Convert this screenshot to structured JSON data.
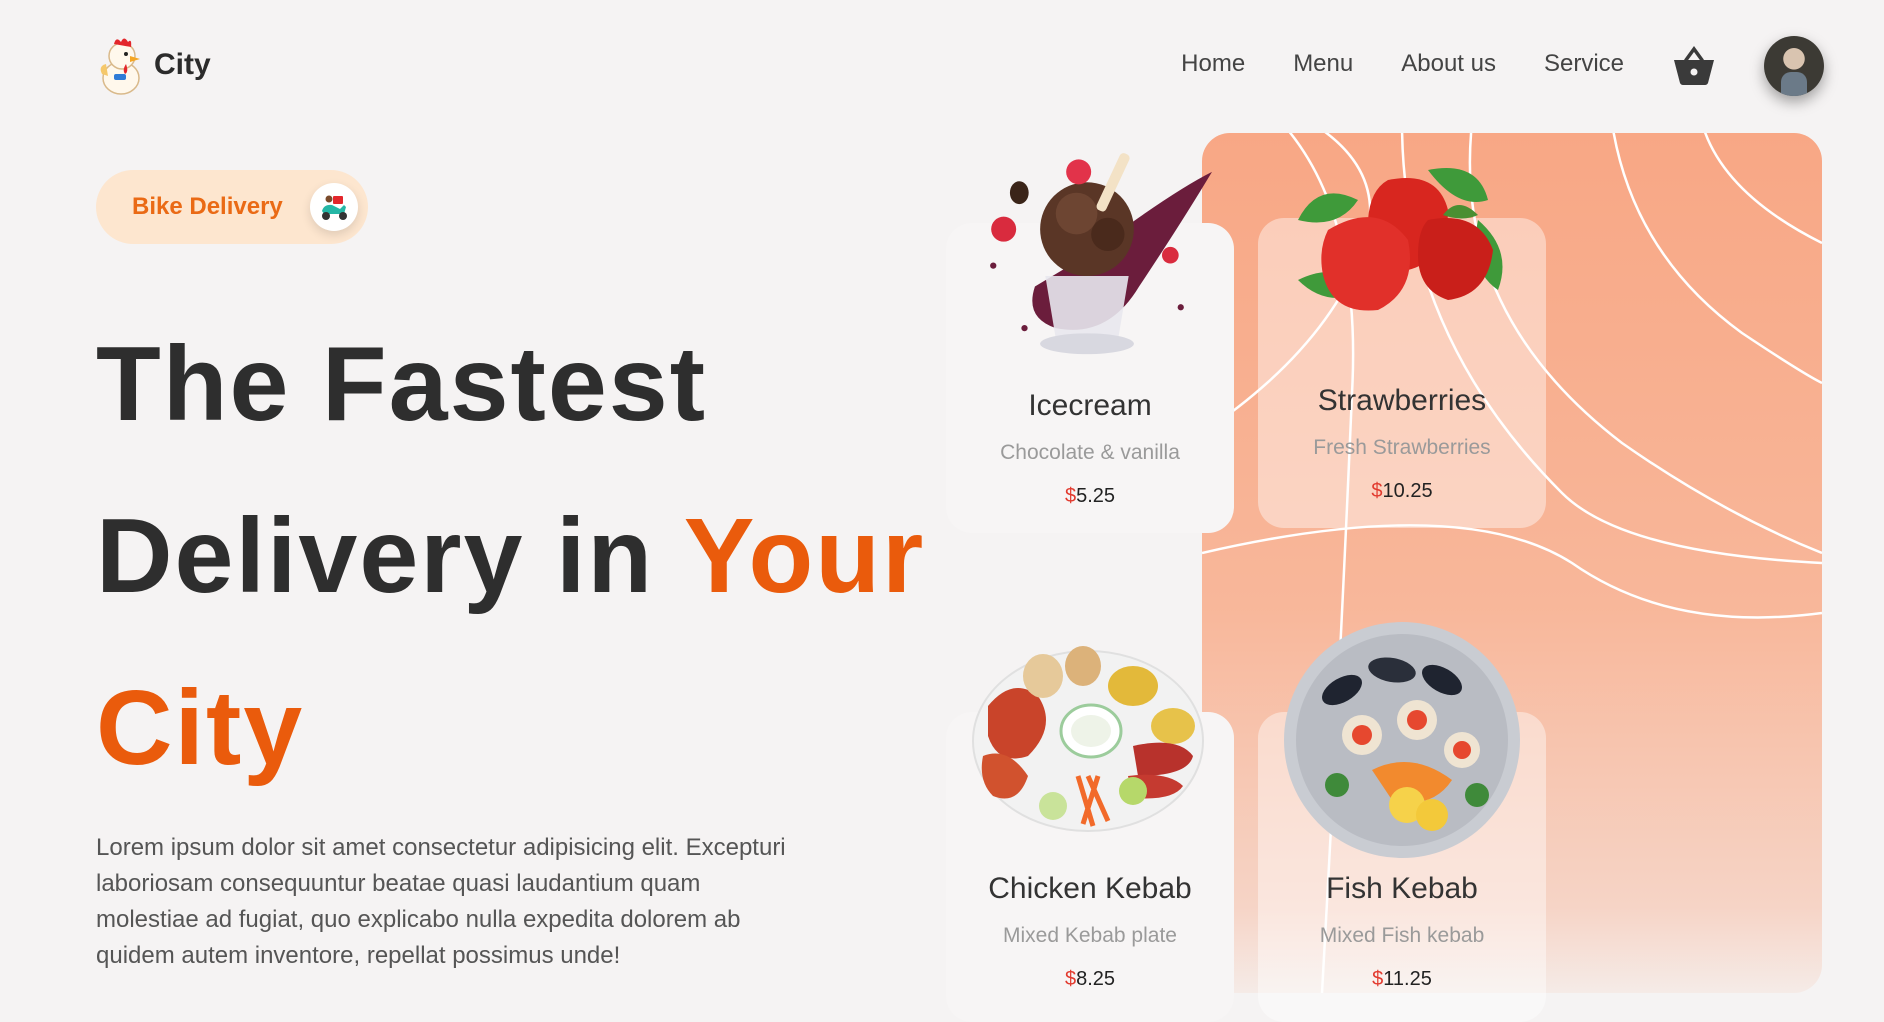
{
  "header": {
    "brand": "City",
    "nav": [
      "Home",
      "Menu",
      "About us",
      "Service"
    ]
  },
  "badge": {
    "label": "Bike Delivery"
  },
  "hero": {
    "line1": "The Fastest",
    "line2_dark": "Delivery in ",
    "line2_accent": "Your",
    "line3_accent": "City"
  },
  "description": "Lorem ipsum dolor sit amet consectetur adipisicing elit. Excepturi laboriosam consequuntur beatae quasi laudantium quam molestiae ad fugiat, quo explicabo nulla expedita dolorem ab quidem autem inventore, repellat possimus unde!",
  "cards": [
    {
      "name": "Icecream",
      "desc": "Chocolate & vanilla",
      "currency": "$",
      "price": "5.25"
    },
    {
      "name": "Strawberries",
      "desc": "Fresh Strawberries",
      "currency": "$",
      "price": "10.25"
    },
    {
      "name": "Chicken Kebab",
      "desc": "Mixed Kebab plate",
      "currency": "$",
      "price": "8.25"
    },
    {
      "name": "Fish Kebab",
      "desc": "Mixed Fish kebab",
      "currency": "$",
      "price": "11.25"
    }
  ],
  "colors": {
    "accent": "#ea5b0c",
    "panel": "#f8a785",
    "badge_bg": "#fde6cf",
    "price_currency": "#e23a2e"
  },
  "icons": [
    "rooster-logo-icon",
    "basket-icon",
    "delivery-scooter-icon"
  ]
}
